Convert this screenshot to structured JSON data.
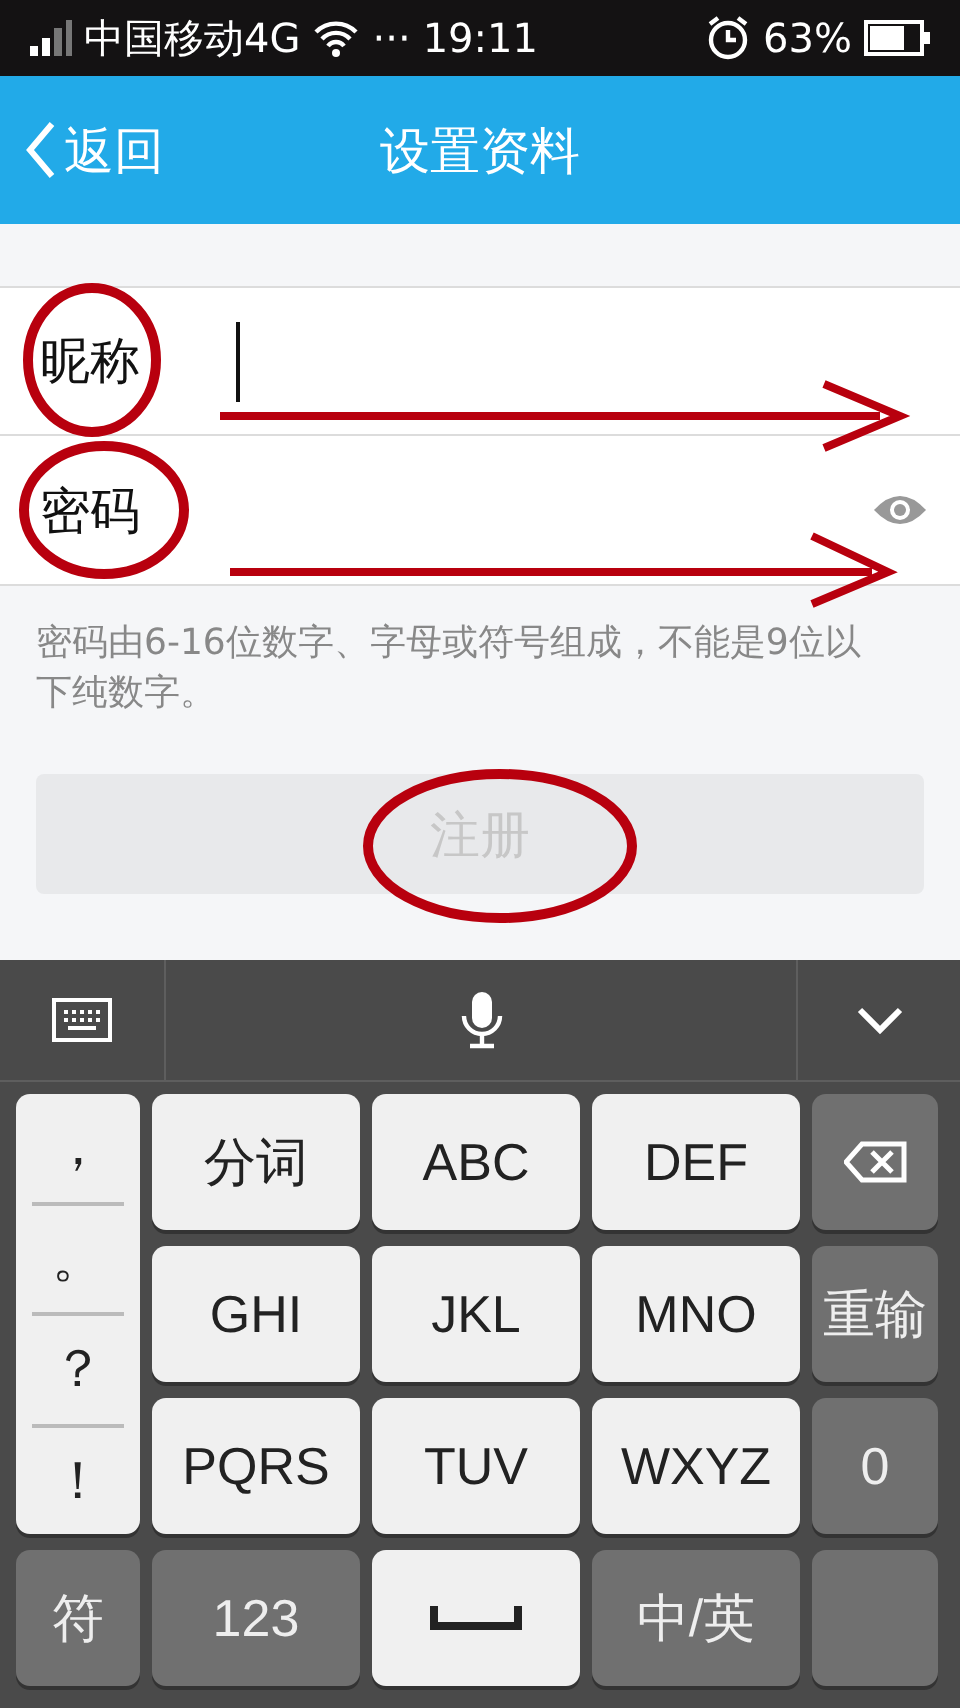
{
  "status_bar": {
    "carrier": "中国移动4G",
    "more": "···",
    "time": "19:11",
    "battery": "63%"
  },
  "nav_bar": {
    "back": "返回",
    "title": "设置资料"
  },
  "fields": [
    {
      "label": "昵称",
      "kind": "text",
      "focused": true
    },
    {
      "label": "密码",
      "kind": "password",
      "focused": false
    }
  ],
  "hint": "密码由6-16位数字、字母或符号组成，不能是9位以下纯数字。",
  "register_button": {
    "label": "注册",
    "disabled": true
  },
  "keyboard": {
    "punctuation": [
      "，",
      "。",
      "？",
      "！"
    ],
    "key_rows": [
      [
        {
          "label": "分词",
          "kind": "light"
        },
        {
          "label": "ABC",
          "kind": "light"
        },
        {
          "label": "DEF",
          "kind": "light"
        },
        {
          "kind": "backspace"
        }
      ],
      [
        {
          "label": "GHI",
          "kind": "light"
        },
        {
          "label": "JKL",
          "kind": "light"
        },
        {
          "label": "MNO",
          "kind": "light"
        },
        {
          "label": "重输",
          "kind": "dark"
        }
      ],
      [
        {
          "label": "PQRS",
          "kind": "light"
        },
        {
          "label": "TUV",
          "kind": "light"
        },
        {
          "label": "WXYZ",
          "kind": "light"
        },
        {
          "label": "0",
          "kind": "dark"
        }
      ]
    ],
    "bottom_row": [
      {
        "label": "符",
        "kind": "dark"
      },
      {
        "label": "123",
        "kind": "dark"
      },
      {
        "kind": "space"
      },
      {
        "label": "中/英",
        "kind": "dark"
      },
      {
        "kind": "enter"
      }
    ]
  }
}
